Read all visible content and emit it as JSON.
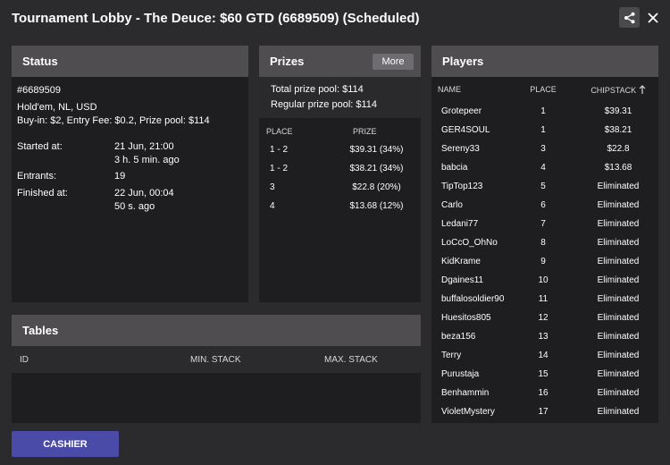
{
  "window": {
    "title": "Tournament Lobby - The Deuce: $60 GTD (6689509) (Scheduled)",
    "share_icon": "share-icon",
    "close_icon": "close-icon"
  },
  "status": {
    "header": "Status",
    "id": "#6689509",
    "game": "Hold'em, NL, USD",
    "buyin": "Buy-in: $2, Entry Fee: $0.2, Prize pool: $114",
    "started_label": "Started at:",
    "started_value": "21 Jun, 21:00",
    "started_ago": "3 h. 5 min. ago",
    "entrants_label": "Entrants:",
    "entrants_value": "19",
    "finished_label": "Finished at:",
    "finished_value": "22 Jun, 00:04",
    "finished_ago": "50 s. ago"
  },
  "prizes": {
    "header": "Prizes",
    "more_label": "More",
    "total_pool": "Total prize pool: $114",
    "regular_pool": "Regular prize pool: $114",
    "columns": [
      "PLACE",
      "PRIZE"
    ],
    "rows": [
      {
        "place": "1 - 2",
        "prize": "$39.31 (34%)"
      },
      {
        "place": "1 - 2",
        "prize": "$38.21 (34%)"
      },
      {
        "place": "3",
        "prize": "$22.8 (20%)"
      },
      {
        "place": "4",
        "prize": "$13.68 (12%)"
      }
    ]
  },
  "players": {
    "header": "Players",
    "columns": {
      "name": "NAME",
      "place": "PLACE",
      "chipstack": "CHIPSTACK"
    },
    "sort_icon": "sort-arrow-up-icon",
    "rows": [
      {
        "name": "Grotepeer",
        "place": "1",
        "chipstack": "$39.31"
      },
      {
        "name": "GER4SOUL",
        "place": "1",
        "chipstack": "$38.21"
      },
      {
        "name": "Sereny33",
        "place": "3",
        "chipstack": "$22.8"
      },
      {
        "name": "babcia",
        "place": "4",
        "chipstack": "$13.68"
      },
      {
        "name": "TipTop123",
        "place": "5",
        "chipstack": "Eliminated"
      },
      {
        "name": "Carlo",
        "place": "6",
        "chipstack": "Eliminated"
      },
      {
        "name": "Ledani77",
        "place": "7",
        "chipstack": "Eliminated"
      },
      {
        "name": "LoCcO_OhNo",
        "place": "8",
        "chipstack": "Eliminated"
      },
      {
        "name": "KidKrame",
        "place": "9",
        "chipstack": "Eliminated"
      },
      {
        "name": "Dgaines11",
        "place": "10",
        "chipstack": "Eliminated"
      },
      {
        "name": "buffalosoldier90",
        "place": "11",
        "chipstack": "Eliminated"
      },
      {
        "name": "Huesitos805",
        "place": "12",
        "chipstack": "Eliminated"
      },
      {
        "name": "beza156",
        "place": "13",
        "chipstack": "Eliminated"
      },
      {
        "name": "Terry",
        "place": "14",
        "chipstack": "Eliminated"
      },
      {
        "name": "Purustaja",
        "place": "15",
        "chipstack": "Eliminated"
      },
      {
        "name": "Benhammin",
        "place": "16",
        "chipstack": "Eliminated"
      },
      {
        "name": "VioletMystery",
        "place": "17",
        "chipstack": "Eliminated"
      }
    ]
  },
  "tables": {
    "header": "Tables",
    "col_id": "ID",
    "col_min": "MIN. STACK",
    "col_max": "MAX. STACK"
  },
  "cashier_label": "CASHIER",
  "colors": {
    "accent": "#4a4aa8",
    "header_bg": "#4f4d50",
    "panel_bg": "#1e1d1f",
    "window_bg": "#2b2a2c"
  }
}
